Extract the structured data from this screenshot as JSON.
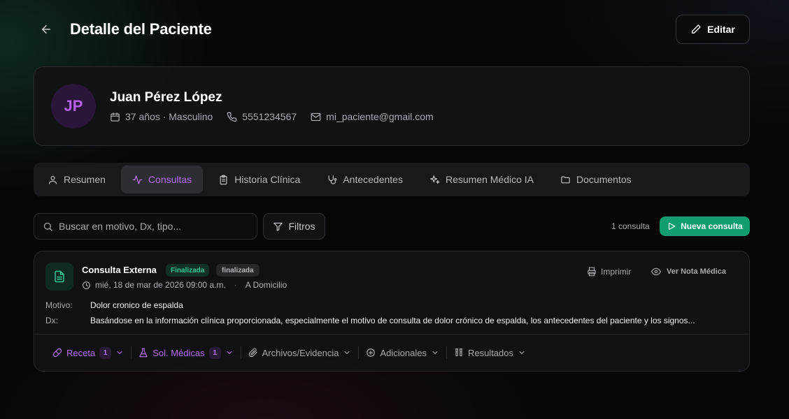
{
  "header": {
    "title": "Detalle del Paciente",
    "edit_label": "Editar"
  },
  "patient": {
    "initials": "JP",
    "name": "Juan Pérez López",
    "age_gender": "37 años · Masculino",
    "phone": "5551234567",
    "email": "mi_paciente@gmail.com"
  },
  "tabs": [
    {
      "label": "Resumen",
      "icon": "user-icon"
    },
    {
      "label": "Consultas",
      "icon": "activity-icon"
    },
    {
      "label": "Historia Clínica",
      "icon": "clipboard-icon"
    },
    {
      "label": "Antecedentes",
      "icon": "stethoscope-icon"
    },
    {
      "label": "Resumen Médico IA",
      "icon": "sparkles-icon"
    },
    {
      "label": "Documentos",
      "icon": "folder-icon"
    }
  ],
  "active_tab": "Consultas",
  "toolbar": {
    "search_placeholder": "Buscar en motivo, Dx, tipo...",
    "filters_label": "Filtros",
    "count_text": "1 consulta",
    "new_label": "Nueva consulta"
  },
  "consultation": {
    "title": "Consulta Externa",
    "status_badge": "Finalizada",
    "state_badge": "finalizada",
    "datetime": "mié, 18 de mar de 2026 09:00 a.m.",
    "location": "A Domicilio",
    "print_label": "Imprimir",
    "note_label": "Ver Nota Médica",
    "motivo_label": "Motivo:",
    "motivo_value": "Dolor cronico de espalda",
    "dx_label": "Dx:",
    "dx_value": "Basándose en la información clínica proporcionada, especialmente el motivo de consulta de dolor crónico de espalda, los antecedentes del paciente y los signos...",
    "actions": {
      "receta": {
        "label": "Receta",
        "count": "1"
      },
      "sol_medicas": {
        "label": "Sol. Médicas",
        "count": "1"
      },
      "archivos": {
        "label": "Archivos/Evidencia"
      },
      "adicionales": {
        "label": "Adicionales"
      },
      "resultados": {
        "label": "Resultados"
      }
    }
  },
  "colors": {
    "accent_purple": "#b86ef0",
    "accent_green": "#0f9d71",
    "background": "#070708"
  }
}
